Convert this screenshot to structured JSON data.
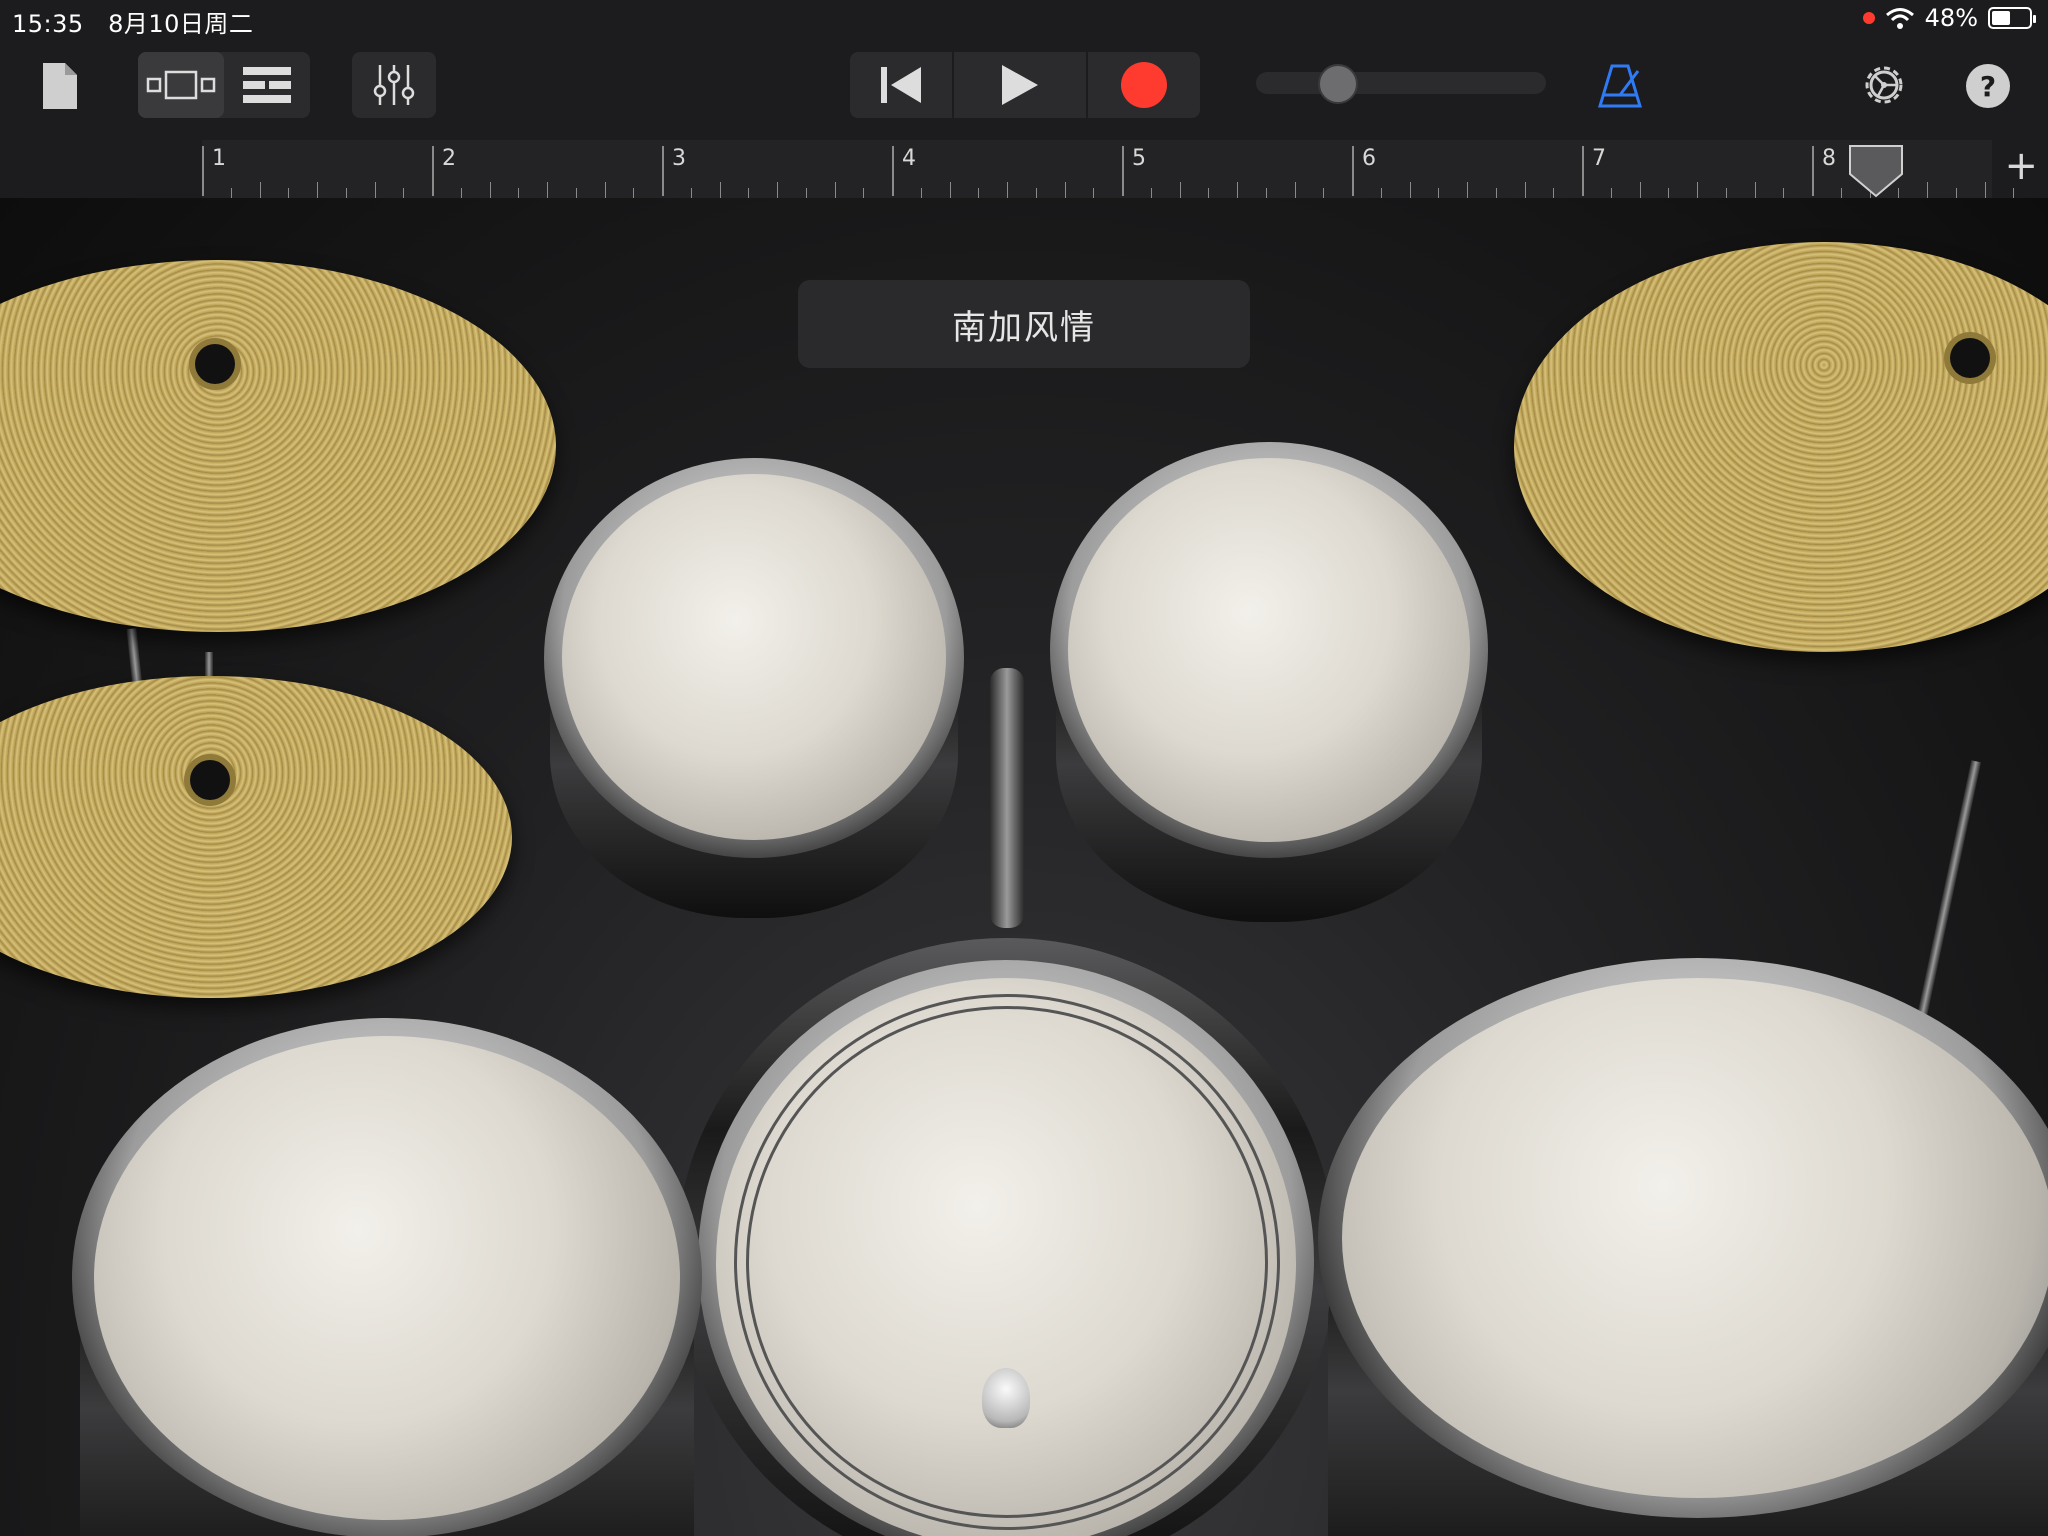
{
  "status_bar": {
    "time": "15:35",
    "date": "8月10日周二",
    "battery": "48%",
    "recording_dot_color": "#ff3b30"
  },
  "toolbar": {
    "my_songs_icon": "document-icon",
    "view_icons": [
      "instrument-view-icon",
      "tracks-view-icon"
    ],
    "mixer_icon": "mixer-sliders-icon",
    "transport": [
      "skip-to-start-icon",
      "play-icon",
      "record-icon"
    ],
    "metronome_icon": "metronome-icon",
    "settings_icon": "gear-icon",
    "help_label": "?",
    "accent_color": "#2f7bf6",
    "master_volume": 0.22
  },
  "ruler": {
    "bars": [
      "1",
      "2",
      "3",
      "4",
      "5",
      "6",
      "7",
      "8"
    ],
    "add_label": "+"
  },
  "kit": {
    "name": "南加风情"
  }
}
